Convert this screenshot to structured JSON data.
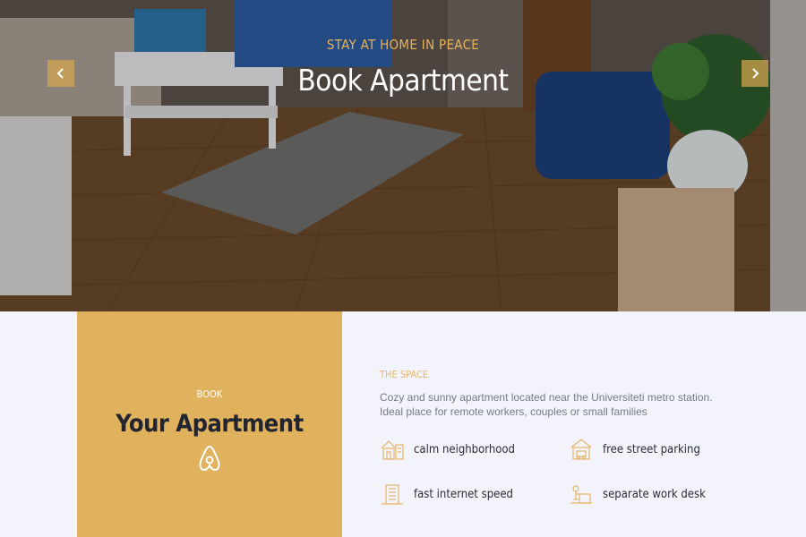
{
  "hero": {
    "eyebrow": "STAY AT HOME IN PEACE",
    "title": "Book Apartment",
    "prev_icon": "chevron-left-icon",
    "next_icon": "chevron-right-icon"
  },
  "book": {
    "eyebrow": "BOOK",
    "title": "Your Apartment",
    "icon": "airbnb-icon"
  },
  "space": {
    "label": "THE SPACE",
    "description": "Cozy and sunny apartment located near the Universiteti metro station. Ideal place for remote workers, couples or small families",
    "features": [
      {
        "label": "calm neighborhood",
        "icon": "neighborhood-icon"
      },
      {
        "label": "free street parking",
        "icon": "parking-icon"
      },
      {
        "label": "fast internet speed",
        "icon": "building-icon"
      },
      {
        "label": "separate work desk",
        "icon": "desk-icon"
      }
    ]
  },
  "colors": {
    "accent": "#e1b25e",
    "accent_text": "#e7b56a",
    "background": "#f3f4fb",
    "dark_text": "#22252f"
  }
}
